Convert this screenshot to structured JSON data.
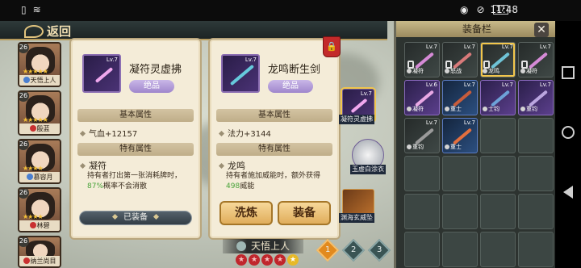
{
  "status_bar": {
    "left_icons": [
      "sim-icon",
      "wifi-icon"
    ],
    "right_icons": [
      "eye-icon",
      "mute-icon",
      "battery-icon"
    ],
    "battery": "17",
    "time": "11:48"
  },
  "topbar": {
    "back_label": "返回"
  },
  "heroes": [
    {
      "level": "26",
      "stars": "★★★★★",
      "name": "天悟上人",
      "dot_color": "#4a7fd0"
    },
    {
      "level": "26",
      "stars": "★★★★★",
      "name": "殷蓝",
      "dot_color": "#c93030"
    },
    {
      "level": "26",
      "stars": "★★★★",
      "name": "慕容月",
      "dot_color": "#4a7fd0"
    },
    {
      "level": "26",
      "stars": "★★★★",
      "name": "林碧",
      "dot_color": "#c93030"
    },
    {
      "level": "26",
      "stars": "★★★★",
      "name": "纳兰尚目",
      "dot_color": "#c93030"
    }
  ],
  "panel_left": {
    "item_name": "凝符灵虚拂",
    "level": "Lv.7",
    "rarity": "绝品",
    "base_attr_title": "基本属性",
    "base_attr": "气血+12157",
    "special_attr_title": "特有属性",
    "skill_name": "凝符",
    "skill_desc_1": "持有者打出第一张消耗牌时，",
    "skill_pct": "87%",
    "skill_desc_2": "概率不会消散",
    "status": "已装备"
  },
  "panel_right": {
    "item_name": "龙鸣断生剑",
    "level": "Lv.7",
    "rarity": "绝品",
    "base_attr_title": "基本属性",
    "base_attr": "法力+3144",
    "special_attr_title": "特有属性",
    "skill_name": "龙鸣",
    "skill_desc_1": "持有者施加威能时，额外获得",
    "skill_pct": "498",
    "skill_desc_2": "威能",
    "btn_refine": "洗炼",
    "btn_equip": "装备"
  },
  "scene_items": [
    {
      "label": "凝符灵虚拂",
      "level": "Lv.7"
    },
    {
      "label": "玉虚白涂衣",
      "level": ""
    },
    {
      "label": "渊海玄威坠",
      "level": ""
    }
  ],
  "hero_nameplate": "天悟上人",
  "hero_stars": {
    "red": 4,
    "gold": 1
  },
  "pages": [
    "1",
    "2",
    "3"
  ],
  "active_page": "1",
  "inventory": {
    "title": "装备栏",
    "close_label": "✕",
    "items": [
      {
        "tag": "凝符",
        "level": "Lv.7",
        "kind": "plain",
        "color": "#d58ad6",
        "locked": true
      },
      {
        "tag": "怒战",
        "level": "Lv.7",
        "kind": "plain",
        "color": "#d87a7a",
        "locked": true
      },
      {
        "tag": "龙鸣",
        "level": "Lv.7",
        "kind": "plain",
        "color": "#6fc3d6",
        "locked": true,
        "selected": true
      },
      {
        "tag": "凝符",
        "level": "Lv.7",
        "kind": "plain",
        "color": "#d58ad6",
        "locked": true
      },
      {
        "tag": "凝符",
        "level": "Lv.6",
        "kind": "purple",
        "color": "#e9a8e5",
        "locked": false
      },
      {
        "tag": "重士",
        "level": "Lv.7",
        "kind": "blue",
        "color": "#c75c3b",
        "locked": false
      },
      {
        "tag": "士钧",
        "level": "Lv.7",
        "kind": "purple",
        "color": "#6da2d8",
        "locked": false
      },
      {
        "tag": "重钧",
        "level": "Lv.7",
        "kind": "purple",
        "color": "#bba6e0",
        "locked": false
      },
      {
        "tag": "重钧",
        "level": "Lv.7",
        "kind": "plain",
        "color": "#9a9a9a",
        "locked": false
      },
      {
        "tag": "重士",
        "level": "Lv.7",
        "kind": "blue",
        "color": "#e36f3e",
        "locked": false
      }
    ],
    "empty_slots": 14
  }
}
